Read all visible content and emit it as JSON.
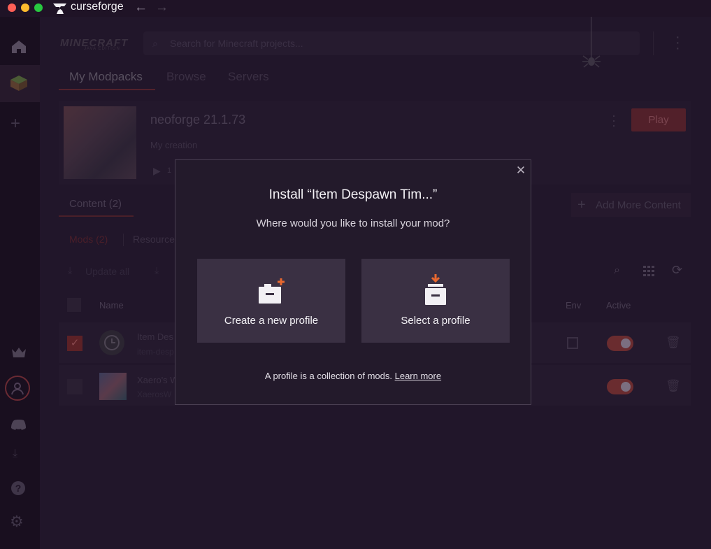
{
  "titlebar": {
    "app_name": "curseforge"
  },
  "sidebar": {
    "items": [
      "home-icon",
      "modpack-icon",
      "add-icon",
      "crown-icon",
      "account-icon",
      "discord-icon",
      "download-icon",
      "help-icon",
      "settings-icon"
    ]
  },
  "header": {
    "game_logo_line1": "MINECRAFT",
    "game_logo_line2": "JAVA EDITION",
    "search_placeholder": "Search for Minecraft projects..."
  },
  "tabs": [
    "My Modpacks",
    "Browse",
    "Servers"
  ],
  "profile": {
    "name": "neoforge 21.1.73",
    "subtitle": "My creation",
    "play_label": "Play",
    "play_count_fragment": "1"
  },
  "content": {
    "tab_label": "Content (2)",
    "add_more_label": "Add More Content",
    "subtabs": [
      "Mods (2)",
      "Resource"
    ],
    "update_all": "Update all"
  },
  "table": {
    "headers": {
      "name": "Name",
      "env": "Env",
      "active": "Active"
    },
    "rows": [
      {
        "title": "Item Des",
        "subtitle": "item-desp",
        "checked": true,
        "active": true
      },
      {
        "title": "Xaero's W",
        "subtitle": "XaerosW",
        "checked": false,
        "active": true
      }
    ]
  },
  "modal": {
    "title": "Install “Item Despawn Tim...”",
    "subtitle": "Where would you like to install your mod?",
    "option_create": "Create a new profile",
    "option_select": "Select a profile",
    "footer_text": "A profile is a collection of mods.",
    "footer_link": "Learn more",
    "accent": "#e8682f"
  }
}
